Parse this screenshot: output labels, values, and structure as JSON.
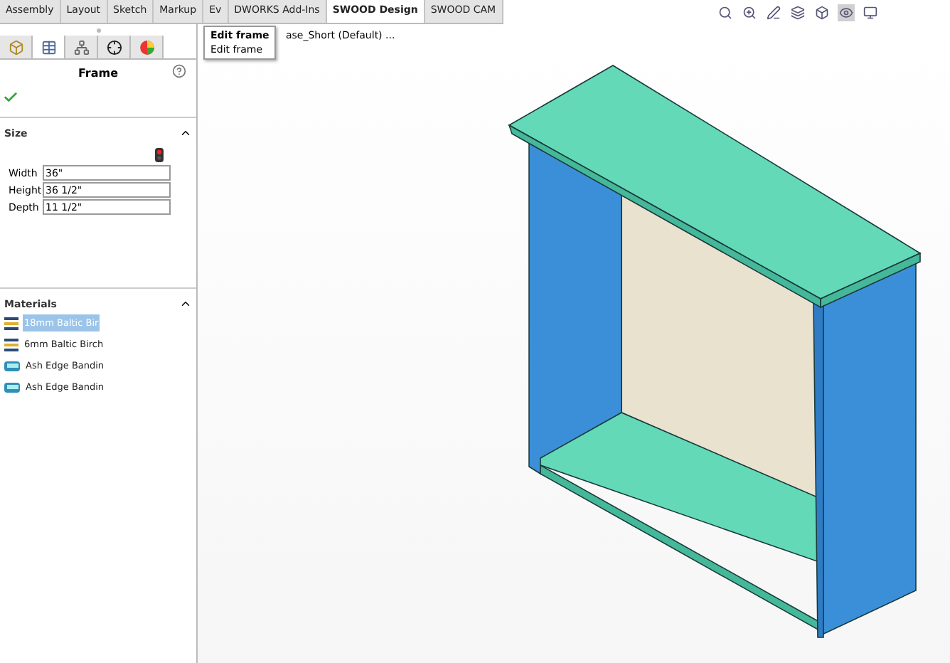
{
  "ribbon_tabs": [
    {
      "label": "Assembly",
      "selected": false
    },
    {
      "label": "Layout",
      "selected": false
    },
    {
      "label": "Sketch",
      "selected": false
    },
    {
      "label": "Markup",
      "selected": false
    },
    {
      "label": "Ev",
      "selected": false
    },
    {
      "label": "DWORKS Add-Ins",
      "selected": false
    },
    {
      "label": "SWOOD Design",
      "selected": true
    },
    {
      "label": "SWOOD CAM",
      "selected": false
    }
  ],
  "tooltip": {
    "title": "Edit frame",
    "description": "Edit frame"
  },
  "tree_item": "ase_Short (Default) ...",
  "panel": {
    "title": "Frame",
    "tabs": [
      {
        "kind": "part",
        "selected": false
      },
      {
        "kind": "list",
        "selected": true
      },
      {
        "kind": "config",
        "selected": false
      },
      {
        "kind": "target",
        "selected": false
      },
      {
        "kind": "appearance",
        "selected": false
      }
    ],
    "size": {
      "title": "Size",
      "expanded": true,
      "fields": [
        {
          "label": "Width",
          "value": "36\""
        },
        {
          "label": "Height",
          "value": "36 1/2\""
        },
        {
          "label": "Depth",
          "value": "11 1/2\""
        }
      ]
    },
    "materials": {
      "title": "Materials",
      "expanded": true,
      "items": [
        {
          "label": "18mm Baltic Bir",
          "kind": "sheet",
          "selected": true
        },
        {
          "label": "6mm Baltic Birch",
          "kind": "sheet",
          "selected": false
        },
        {
          "label": "Ash Edge Bandin",
          "kind": "edge",
          "selected": false
        },
        {
          "label": "Ash Edge Bandin",
          "kind": "edge",
          "selected": false
        }
      ]
    }
  }
}
